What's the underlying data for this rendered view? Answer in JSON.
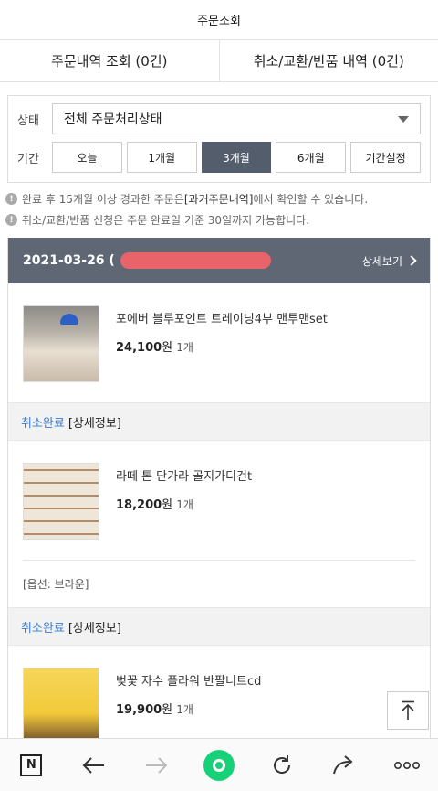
{
  "header": {
    "title": "주문조회"
  },
  "tabs": [
    {
      "label": "주문내역 조회 (0건)"
    },
    {
      "label": "취소/교환/반품 내역 (0건)"
    }
  ],
  "filter": {
    "status_label": "상태",
    "status_value": "전체 주문처리상태",
    "period_label": "기간",
    "periods": [
      "오늘",
      "1개월",
      "3개월",
      "6개월",
      "기간설정"
    ],
    "active_period": "3개월"
  },
  "notices": {
    "line1_pre": "완료 후 15개월 이상 경과한 주문은 ",
    "line1_bold": "[과거주문내역]",
    "line1_post": "에서 확인할 수 있습니다.",
    "line2": "취소/교환/반품 신청은 주문 완료일 기준 30일까지 가능합니다."
  },
  "order": {
    "date": "2021-03-26 (",
    "detail_link": "상세보기",
    "items": [
      {
        "name": "포에버 블루포인트 트레이닝4부 맨투맨set",
        "price": "24,100",
        "unit": "원",
        "qty": "1개",
        "status": "취소완료",
        "status_detail": "[상세정보]"
      },
      {
        "name": "라떼 톤 단가라 골지가디건t",
        "price": "18,200",
        "unit": "원",
        "qty": "1개",
        "option": "[옵션: 브라운]",
        "status": "취소완료",
        "status_detail": "[상세정보]"
      },
      {
        "name": "벚꽃 자수 플라워 반팔니트cd",
        "price": "19,900",
        "unit": "원",
        "qty": "1개"
      }
    ]
  },
  "icons": {
    "info": "info-circle-icon",
    "top": "arrow-up-icon",
    "nav": [
      "naver-n-icon",
      "back-arrow-icon",
      "forward-arrow-icon",
      "green-home-icon",
      "refresh-icon",
      "share-icon",
      "more-icon"
    ]
  },
  "colors": {
    "accent_blue": "#3a7bd5",
    "header_gray": "#5f6774",
    "active_btn": "#545d6b",
    "nav_green": "#17d077"
  }
}
